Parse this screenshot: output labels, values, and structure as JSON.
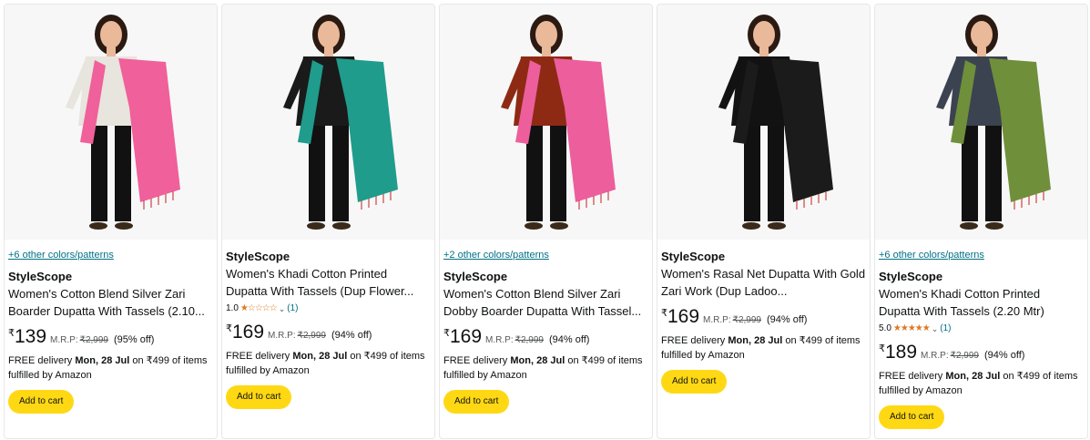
{
  "products": [
    {
      "colors_link": "+6 other colors/patterns",
      "brand": "StyleScope",
      "title": "Women's Cotton Blend Silver Zari Boarder Dupatta With Tassels (2.10...",
      "rating": "",
      "rating_count": "",
      "currency": "₹",
      "price": "139",
      "mrp_label": "M.R.P:",
      "mrp": "₹2,999",
      "discount": "(95% off)",
      "delivery_prefix": "FREE delivery ",
      "delivery_date": "Mon, 28 Jul",
      "delivery_suffix": " on ₹499 of items fulfilled by Amazon",
      "cart_label": "Add to cart",
      "dupatta_color": "#f0609a",
      "top_color": "#e8e4de"
    },
    {
      "colors_link": "",
      "brand": "StyleScope",
      "title": "Women's Khadi Cotton Printed Dupatta With Tassels (Dup Flower...",
      "rating": "1.0",
      "rating_count": "(1)",
      "currency": "₹",
      "price": "169",
      "mrp_label": "M.R.P:",
      "mrp": "₹2,999",
      "discount": "(94% off)",
      "delivery_prefix": "FREE delivery ",
      "delivery_date": "Mon, 28 Jul",
      "delivery_suffix": " on ₹499 of items fulfilled by Amazon",
      "cart_label": "Add to cart",
      "dupatta_color": "#1f9c8c",
      "top_color": "#1a1a1a"
    },
    {
      "colors_link": "+2 other colors/patterns",
      "brand": "StyleScope",
      "title": "Women's Cotton Blend Silver Zari Dobby Boarder Dupatta With Tassel...",
      "rating": "",
      "rating_count": "",
      "currency": "₹",
      "price": "169",
      "mrp_label": "M.R.P:",
      "mrp": "₹2,999",
      "discount": "(94% off)",
      "delivery_prefix": "FREE delivery ",
      "delivery_date": "Mon, 28 Jul",
      "delivery_suffix": " on ₹499 of items fulfilled by Amazon",
      "cart_label": "Add to cart",
      "dupatta_color": "#ec5f9c",
      "top_color": "#8e2a14"
    },
    {
      "colors_link": "",
      "brand": "StyleScope",
      "title": "Women's Rasal Net Dupatta With Gold Zari Work (Dup Ladoo...",
      "rating": "",
      "rating_count": "",
      "currency": "₹",
      "price": "169",
      "mrp_label": "M.R.P:",
      "mrp": "₹2,999",
      "discount": "(94% off)",
      "delivery_prefix": "FREE delivery ",
      "delivery_date": "Mon, 28 Jul",
      "delivery_suffix": " on ₹499 of items fulfilled by Amazon",
      "cart_label": "Add to cart",
      "dupatta_color": "#1b1b1b",
      "top_color": "#121212"
    },
    {
      "colors_link": "+6 other colors/patterns",
      "brand": "StyleScope",
      "title": "Women's Khadi Cotton Printed Dupatta With Tassels (2.20 Mtr)",
      "rating": "5.0",
      "rating_count": "(1)",
      "currency": "₹",
      "price": "189",
      "mrp_label": "M.R.P:",
      "mrp": "₹2,999",
      "discount": "(94% off)",
      "delivery_prefix": "FREE delivery ",
      "delivery_date": "Mon, 28 Jul",
      "delivery_suffix": " on ₹499 of items fulfilled by Amazon",
      "cart_label": "Add to cart",
      "dupatta_color": "#6f8f3a",
      "top_color": "#3b4250"
    }
  ],
  "colors": {
    "link": "#007185",
    "star": "#de7921",
    "cart_button": "#ffd814"
  }
}
